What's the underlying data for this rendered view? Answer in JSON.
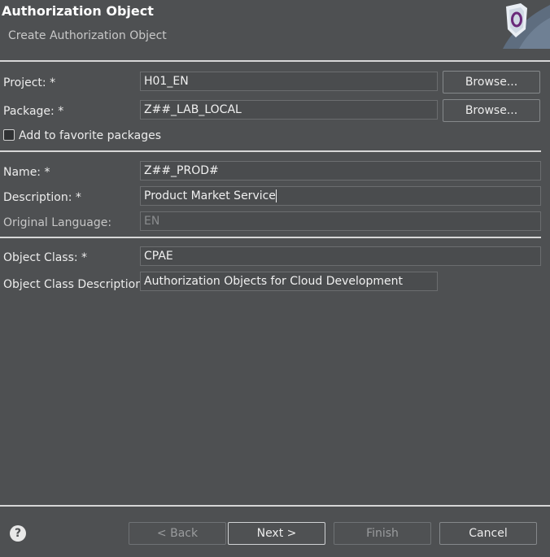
{
  "header": {
    "title": "Authorization Object",
    "subtitle": "Create Authorization Object"
  },
  "project": {
    "label": "Project: *",
    "value": "H01_EN",
    "browse": "Browse..."
  },
  "package": {
    "label": "Package: *",
    "value": "Z##_LAB_LOCAL",
    "browse": "Browse...",
    "favorite_label": "Add to favorite packages",
    "favorite_checked": false
  },
  "name": {
    "label": "Name: *",
    "value": "Z##_PROD#"
  },
  "description": {
    "label": "Description: *",
    "value": "Product Market Service"
  },
  "original_language": {
    "label": "Original Language:",
    "value": "EN"
  },
  "object_class": {
    "label": "Object Class: *",
    "value": "CPAE"
  },
  "object_class_description": {
    "label": "Object Class Description:",
    "value": "Authorization Objects for Cloud Development"
  },
  "footer": {
    "help_icon": "?",
    "back": "< Back",
    "next": "Next >",
    "finish": "Finish",
    "cancel": "Cancel"
  },
  "colors": {
    "background": "#4e5052",
    "separator": "#d7d7d7",
    "field_border": "#6b6d6f",
    "logo_shield": "#6a2a7a"
  }
}
